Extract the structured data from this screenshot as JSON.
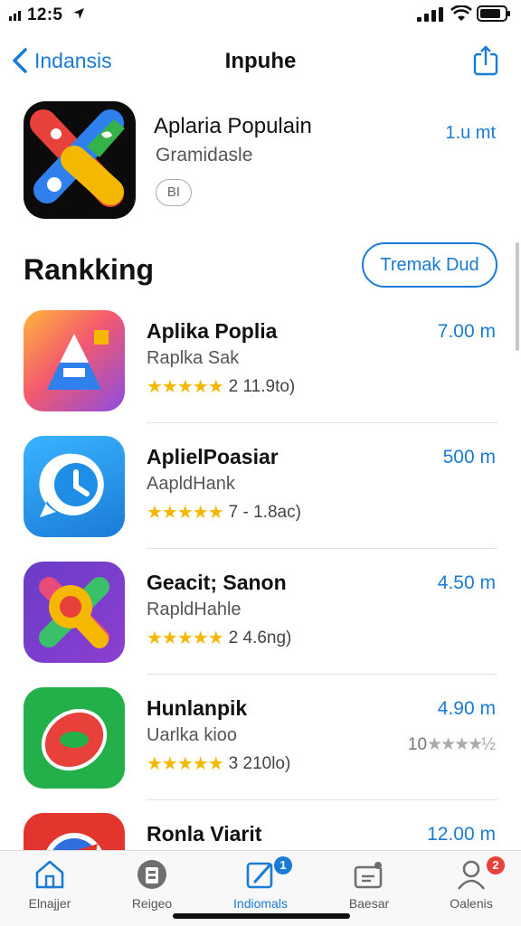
{
  "status": {
    "time": "12:5"
  },
  "nav": {
    "back_label": "Indansis",
    "title": "Inpuhe"
  },
  "featured": {
    "name": "Aplaria Populain",
    "subtitle": "Gramidasle",
    "pill": "BI",
    "size": "1.u mt"
  },
  "section": {
    "title": "Rankking",
    "button": "Tremak Dud"
  },
  "apps": [
    {
      "name": "Aplika Poplia",
      "subtitle": "Raplka Sak",
      "stars": "★★★★★",
      "count": "2  11.9to)",
      "size": "7.00 m"
    },
    {
      "name": "AplielPoasiar",
      "subtitle": "AapldHank",
      "stars": "★★★★★",
      "count": "7 - 1.8ac)",
      "size": "500 m"
    },
    {
      "name": "Geacit; Sanon",
      "subtitle": "RapldHahle",
      "stars": "★★★★★",
      "count": "2  4.6ng)",
      "size": "4.50 m"
    },
    {
      "name": "Hunlanpik",
      "subtitle": "Uarlka kioo",
      "stars": "★★★★★",
      "count": "3  210lo)",
      "size": "4.90 m",
      "extra": "10",
      "extra_stars": "★★★★½"
    },
    {
      "name": "Ronla Viarit",
      "size": "12.00 m"
    }
  ],
  "tabs": [
    {
      "label": "Elnajjer",
      "icon": "home-icon"
    },
    {
      "label": "Reigeo",
      "icon": "games-icon"
    },
    {
      "label": "Indiomals",
      "icon": "apps-icon",
      "badge": "1"
    },
    {
      "label": "Baesar",
      "icon": "updates-icon"
    },
    {
      "label": "Oalenis",
      "icon": "profile-icon",
      "badge": "2"
    }
  ],
  "colors": {
    "accent": "#1a7bd6",
    "star": "#f5b800",
    "badge_red": "#e8403a"
  }
}
